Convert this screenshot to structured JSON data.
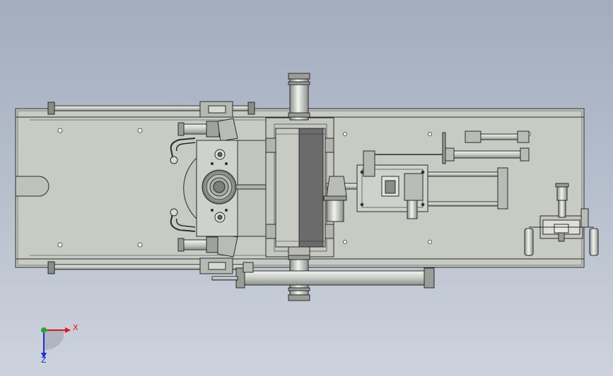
{
  "viewport": {
    "background_top": "#a3adbd",
    "background_bottom": "#cdd3dd"
  },
  "colors": {
    "part_fill": "#c8cbc4",
    "part_fill_light": "#d9dbd6",
    "edge": "#2b2b2b",
    "shadow_block": "#6b6b6b",
    "axis_x": "#e0161b",
    "axis_y": "#1a2fd6",
    "axis_z": "#1fa83a"
  },
  "triad": {
    "x_label": "X",
    "z_label": "Z",
    "icon": "coordinate-triad-icon"
  }
}
